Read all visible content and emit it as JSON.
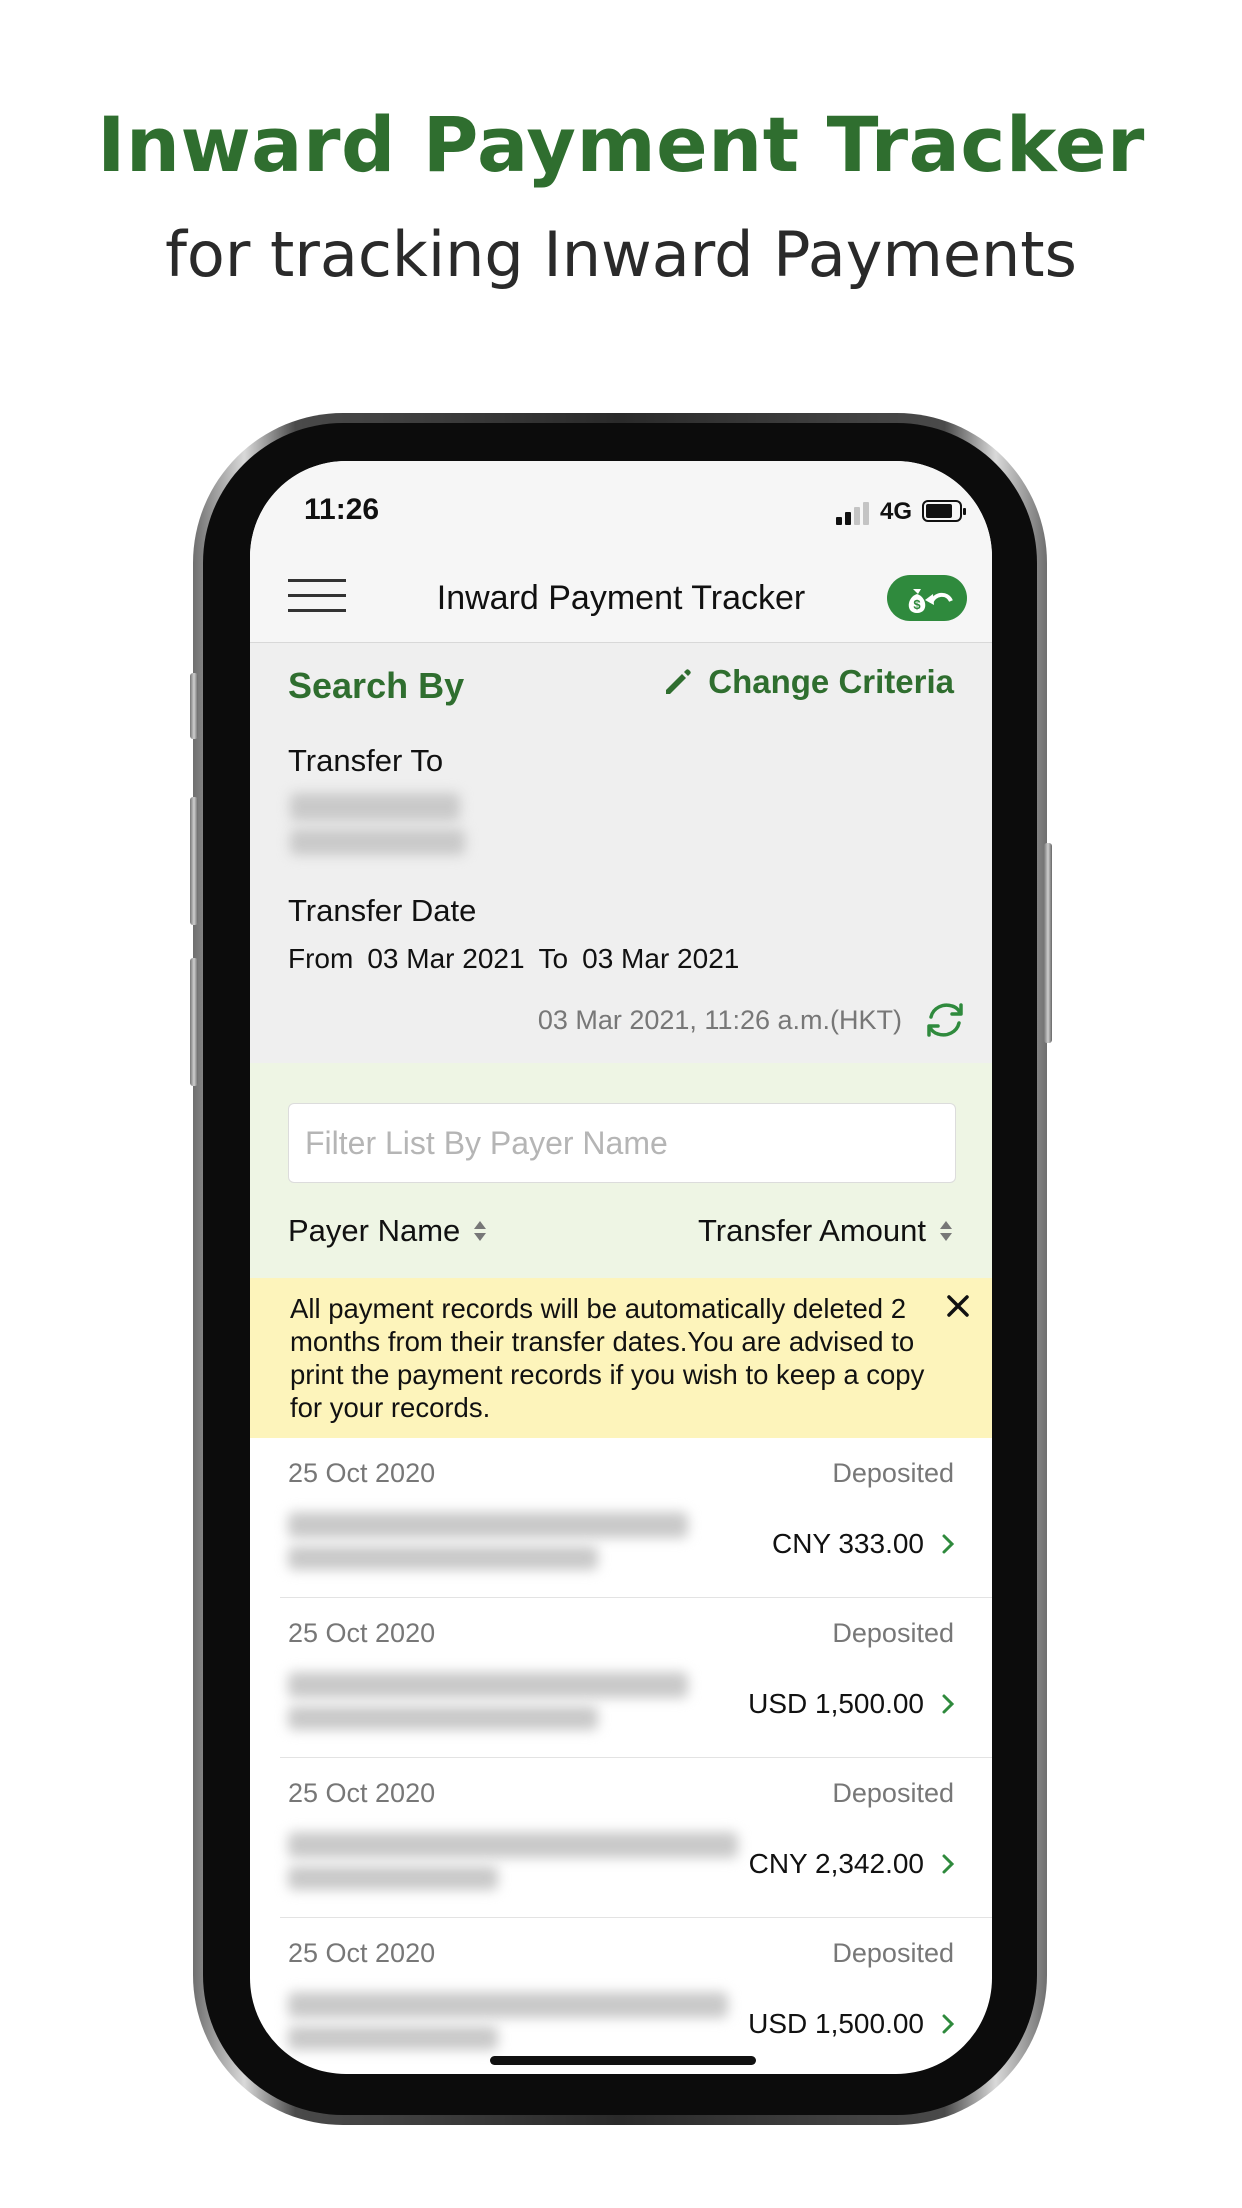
{
  "promo": {
    "title": "Inward Payment Tracker",
    "subtitle": "for tracking Inward Payments"
  },
  "status_bar": {
    "time": "11:26",
    "network": "4G"
  },
  "nav": {
    "title": "Inward Payment Tracker",
    "action_icon": "money-bag-return-icon"
  },
  "search": {
    "heading": "Search By",
    "change_label": "Change Criteria",
    "transfer_to_label": "Transfer To",
    "transfer_date_label": "Transfer Date",
    "from_label": "From",
    "from_date": "03 Mar 2021",
    "to_label": "To",
    "to_date": "03 Mar 2021",
    "updated_at": "03 Mar 2021, 11:26 a.m.(HKT)"
  },
  "filter": {
    "placeholder": "Filter List By Payer Name",
    "value": "",
    "sort_payer_label": "Payer Name",
    "sort_amount_label": "Transfer Amount"
  },
  "notice": {
    "text": "All payment records will be automatically deleted 2 months from their transfer dates.You are advised to print the payment records if you wish to keep a copy for your records."
  },
  "records": [
    {
      "date": "25 Oct 2020",
      "status": "Deposited",
      "amount": "CNY 333.00"
    },
    {
      "date": "25 Oct 2020",
      "status": "Deposited",
      "amount": "USD 1,500.00"
    },
    {
      "date": "25 Oct 2020",
      "status": "Deposited",
      "amount": "CNY 2,342.00"
    },
    {
      "date": "25 Oct 2020",
      "status": "Deposited",
      "amount": "USD 1,500.00"
    }
  ],
  "colors": {
    "brand_green": "#2f6e2f",
    "action_green": "#2f8a3d",
    "notice_yellow": "#fdf4bb",
    "filter_bg": "#eef5e4"
  }
}
